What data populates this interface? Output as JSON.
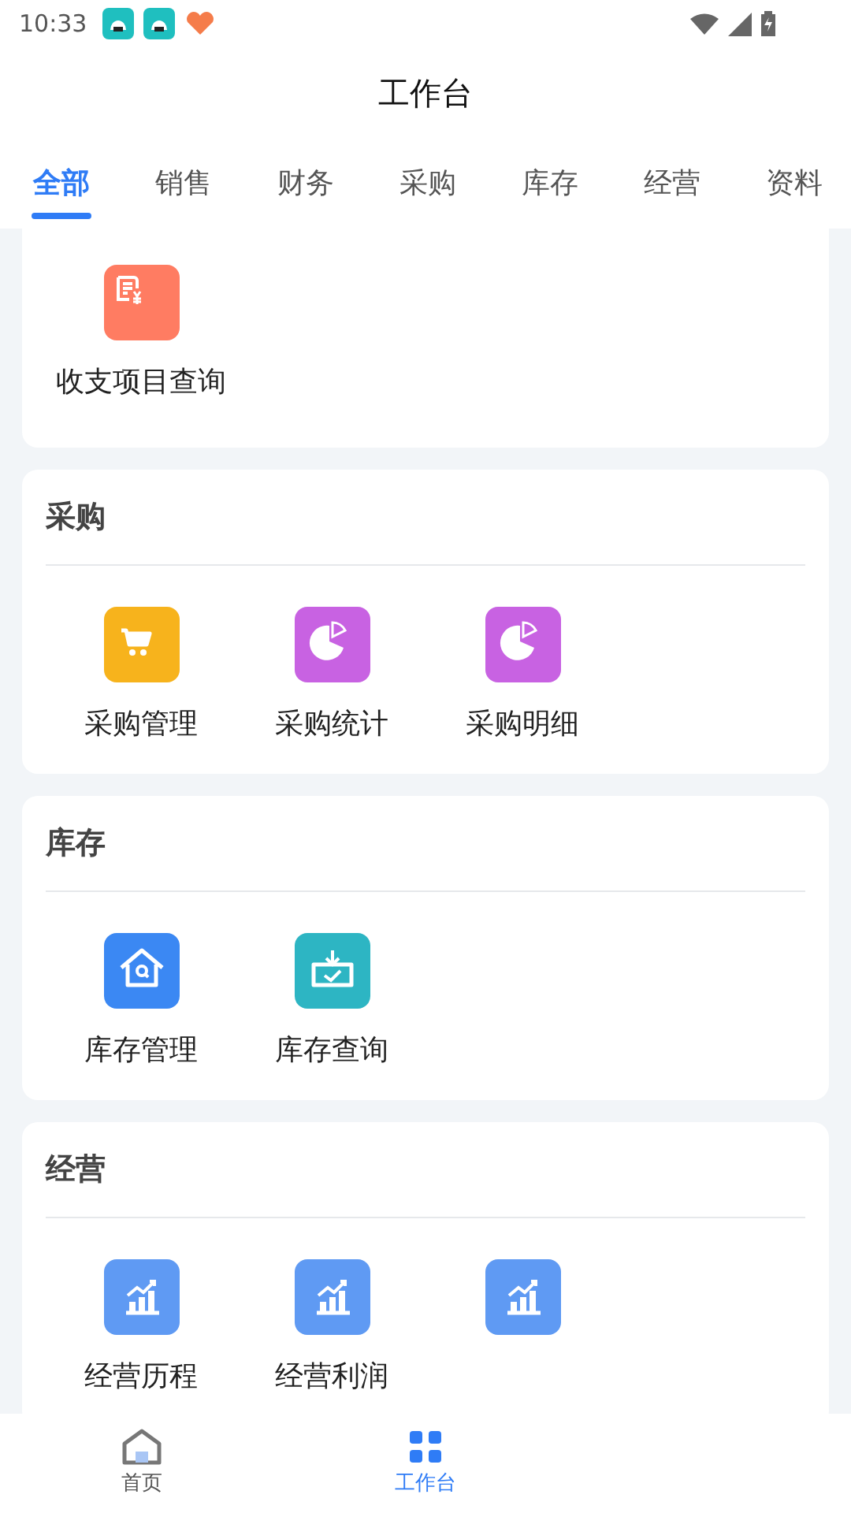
{
  "status_bar": {
    "time": "10:33"
  },
  "title": "工作台",
  "tabs": [
    {
      "label": "全部",
      "selected": true
    },
    {
      "label": "销售",
      "selected": false
    },
    {
      "label": "财务",
      "selected": false
    },
    {
      "label": "采购",
      "selected": false
    },
    {
      "label": "库存",
      "selected": false
    },
    {
      "label": "经营",
      "selected": false
    },
    {
      "label": "资料",
      "selected": false
    }
  ],
  "sections": [
    {
      "items": [
        {
          "label": "收支项目查询",
          "kind": "receipt",
          "color": "#ff7c62"
        }
      ]
    },
    {
      "title": "采购",
      "items": [
        {
          "label": "采购管理",
          "kind": "cart",
          "color": "#f7b31c"
        },
        {
          "label": "采购统计",
          "kind": "pie",
          "color": "#c862e2"
        },
        {
          "label": "采购明细",
          "kind": "pie",
          "color": "#c862e2"
        }
      ]
    },
    {
      "title": "库存",
      "items": [
        {
          "label": "库存管理",
          "kind": "house",
          "color": "#3b88f3"
        },
        {
          "label": "库存查询",
          "kind": "inbox",
          "color": "#2db5c3"
        }
      ]
    },
    {
      "title": "经营",
      "items": [
        {
          "label": "经营历程",
          "kind": "chart",
          "color": "#5f9af3"
        },
        {
          "label": "经营利润",
          "kind": "chart",
          "color": "#5f9af3"
        },
        {
          "kind": "chart",
          "color": "#5f9af3"
        }
      ]
    }
  ],
  "bottom_nav": [
    {
      "label": "首页",
      "selected": false
    },
    {
      "label": "工作台",
      "selected": true
    }
  ]
}
